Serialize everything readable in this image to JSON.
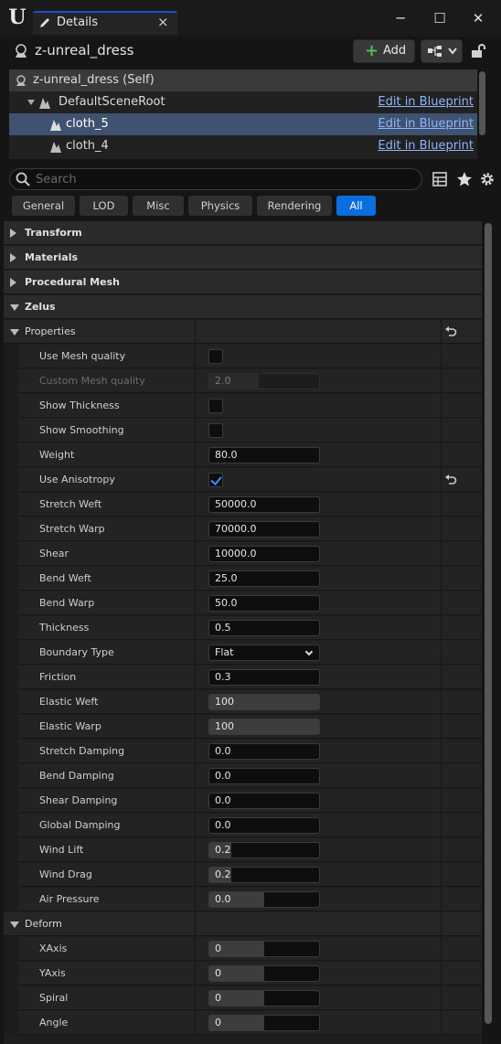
{
  "window": {
    "tab_label": "Details",
    "tab_close": "×",
    "minimize": "─",
    "maximize": "☐",
    "close": "✕"
  },
  "actor": {
    "name": "z-unreal_dress",
    "add_label": "Add"
  },
  "tree": [
    {
      "label": "z-unreal_dress (Self)",
      "link": ""
    },
    {
      "label": "DefaultSceneRoot",
      "link": "Edit in Blueprint"
    },
    {
      "label": "cloth_5",
      "link": "Edit in Blueprint"
    },
    {
      "label": "cloth_4",
      "link": "Edit in Blueprint"
    }
  ],
  "search": {
    "placeholder": "Search"
  },
  "filter_tabs": [
    "General",
    "LOD",
    "Misc",
    "Physics",
    "Rendering",
    "All"
  ],
  "active_filter": "All",
  "categories": {
    "transform": "Transform",
    "materials": "Materials",
    "procedural_mesh": "Procedural Mesh",
    "zelus": "Zelus",
    "properties": "Properties",
    "deform": "Deform"
  },
  "properties": [
    {
      "name": "Use Mesh quality",
      "type": "check",
      "checked": false
    },
    {
      "name": "Custom Mesh quality",
      "type": "value",
      "value": "2.0",
      "disabled": true,
      "fill": 0.45
    },
    {
      "name": "Show Thickness",
      "type": "check",
      "checked": false
    },
    {
      "name": "Show Smoothing",
      "type": "check",
      "checked": false
    },
    {
      "name": "Weight",
      "type": "value",
      "value": "80.0"
    },
    {
      "name": "Use Anisotropy",
      "type": "check",
      "checked": true,
      "reset": true
    },
    {
      "name": "Stretch Weft",
      "type": "value",
      "value": "50000.0"
    },
    {
      "name": "Stretch Warp",
      "type": "value",
      "value": "70000.0"
    },
    {
      "name": "Shear",
      "type": "value",
      "value": "10000.0"
    },
    {
      "name": "Bend Weft",
      "type": "value",
      "value": "25.0"
    },
    {
      "name": "Bend Warp",
      "type": "value",
      "value": "50.0"
    },
    {
      "name": "Thickness",
      "type": "value",
      "value": "0.5"
    },
    {
      "name": "Boundary Type",
      "type": "combo",
      "value": "Flat"
    },
    {
      "name": "Friction",
      "type": "value",
      "value": "0.3"
    },
    {
      "name": "Elastic Weft",
      "type": "value",
      "value": "100",
      "fill": 1.0
    },
    {
      "name": "Elastic Warp",
      "type": "value",
      "value": "100",
      "fill": 1.0
    },
    {
      "name": "Stretch Damping",
      "type": "value",
      "value": "0.0"
    },
    {
      "name": "Bend Damping",
      "type": "value",
      "value": "0.0"
    },
    {
      "name": "Shear Damping",
      "type": "value",
      "value": "0.0"
    },
    {
      "name": "Global Damping",
      "type": "value",
      "value": "0.0"
    },
    {
      "name": "Wind Lift",
      "type": "value",
      "value": "0.2",
      "fill": 0.2
    },
    {
      "name": "Wind Drag",
      "type": "value",
      "value": "0.2",
      "fill": 0.2
    },
    {
      "name": "Air Pressure",
      "type": "value",
      "value": "0.0",
      "fill": 0.5
    }
  ],
  "deform": [
    {
      "name": "XAxis",
      "value": "0",
      "fill": 0.5
    },
    {
      "name": "YAxis",
      "value": "0",
      "fill": 0.5
    },
    {
      "name": "Spiral",
      "value": "0",
      "fill": 0.5
    },
    {
      "name": "Angle",
      "value": "0",
      "fill": 0.5
    }
  ]
}
